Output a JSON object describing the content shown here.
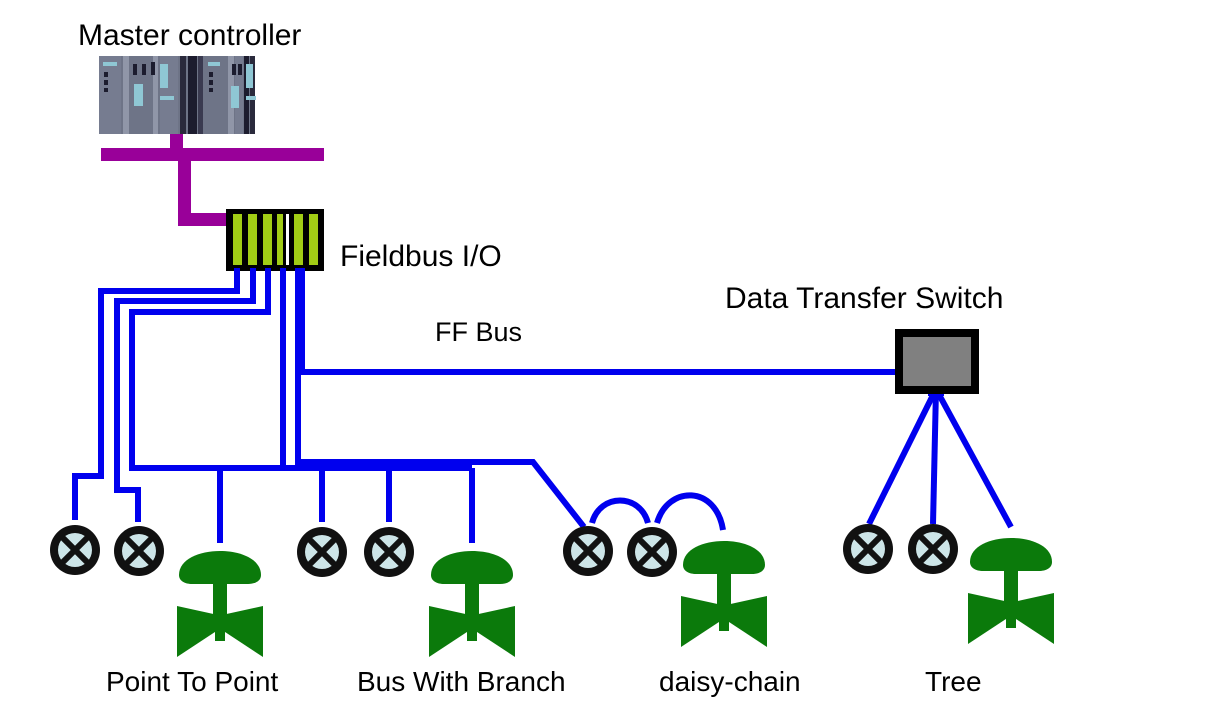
{
  "diagram": {
    "title": "Fieldbus network topology diagram",
    "background_color": "#FFFFFF",
    "labels": {
      "master_controller": "Master controller",
      "fieldbus_io": "Fieldbus I/O",
      "ff_bus": "FF Bus",
      "data_transfer_switch": "Data Transfer Switch"
    },
    "topologies": [
      {
        "id": "point-to-point",
        "label": "Point To Point"
      },
      {
        "id": "bus-with-branch",
        "label": "Bus With Branch"
      },
      {
        "id": "daisy-chain",
        "label": "daisy-chain"
      },
      {
        "id": "tree",
        "label": "Tree"
      }
    ],
    "colors": {
      "fieldbus_wire": "#0000EE",
      "controller_bus": "#990099",
      "valve_green": "#0B7A0B",
      "io_module_stripe": "#A2CD15",
      "io_module_body": "#000000",
      "switch_fill": "#808080",
      "switch_border": "#000000",
      "transmitter_ring": "#111111",
      "transmitter_fill": "#CDE5E8",
      "plc_body": "#6E7487",
      "plc_dark": "#1C1C2E",
      "plc_accent": "#8FC7D4"
    },
    "devices": {
      "transmitter_icon": "circle-x-transmitter-icon",
      "valve_icon": "control-valve-icon",
      "counts": {
        "point_to_point": {
          "transmitters": 2,
          "valves": 1
        },
        "bus_with_branch": {
          "transmitters": 2,
          "valves": 1
        },
        "daisy_chain": {
          "transmitters": 2,
          "valves": 1
        },
        "tree": {
          "transmitters": 2,
          "valves": 1
        }
      }
    }
  }
}
